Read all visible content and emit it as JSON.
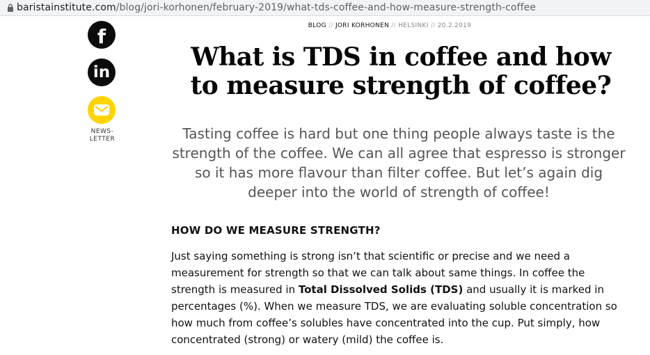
{
  "browser": {
    "url_domain": "baristainstitute.com",
    "url_path": "/blog/jori-korhonen/february-2019/what-tds-coffee-and-how-measure-strength-coffee"
  },
  "social": {
    "facebook_glyph": "f",
    "linkedin_glyph": "in",
    "newsletter_line1": "NEWS-",
    "newsletter_line2": "LETTER",
    "colors": {
      "dark": "#0c0c0c",
      "newsletter": "#ffd400"
    }
  },
  "article": {
    "meta": {
      "section": "BLOG",
      "sep": "//",
      "author": "JORI KORHONEN",
      "location": "HELSINKI",
      "date": "20.2.2019"
    },
    "title_line1": "What is TDS in coffee and how",
    "title_line2": "to measure strength of coffee?",
    "intro": "Tasting coffee is hard but one thing people always taste is the strength of the coffee. We can all agree that espresso is stronger so it has more flavour than filter coffee. But let’s again dig deeper into the world of strength of coffee!",
    "heading": "HOW DO WE MEASURE STRENGTH?",
    "paragraph": {
      "before": "Just saying something is strong isn’t that scientific or precise and we need a measurement for strength so that we can talk about same things. In coffee the strength is measured in ",
      "bold": "Total Dissolved Solids (TDS)",
      "after": " and usually it is marked in percentages (%). When we measure TDS, we are evaluating soluble concentration so how much from coffee’s solubles have concentrated into the cup. Put simply, how concentrated (strong) or watery (mild) the coffee is."
    }
  }
}
